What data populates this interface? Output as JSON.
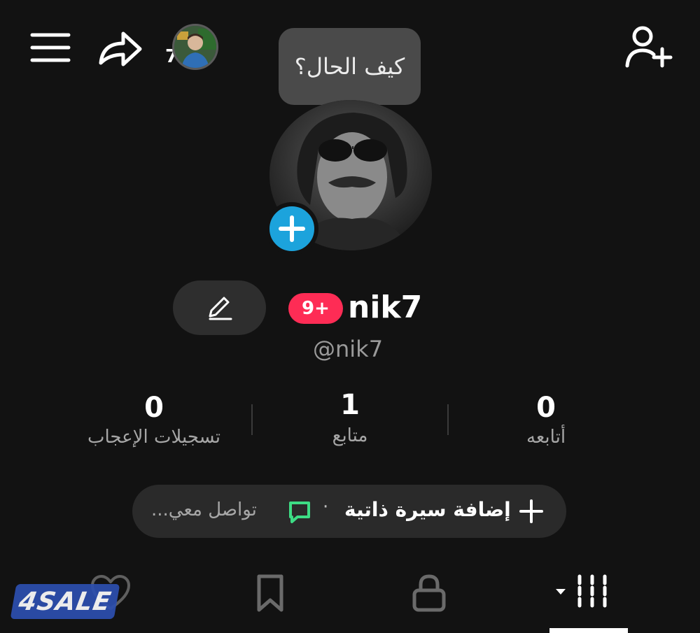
{
  "header": {
    "story_count": "7",
    "note_text": "كيف الحال؟"
  },
  "profile": {
    "display_name": "nik7",
    "badge": "9+",
    "username": "@nik7"
  },
  "stats": [
    {
      "value": "0",
      "label": "تسجيلات الإعجاب"
    },
    {
      "value": "1",
      "label": "متابع"
    },
    {
      "value": "0",
      "label": "أتابعه"
    }
  ],
  "bio": {
    "add_label": "إضافة سيرة ذاتية",
    "separator": "·",
    "contact_label": "تواصل معي..."
  },
  "tabs": [
    {
      "icon": "heart-icon"
    },
    {
      "icon": "bookmark-icon"
    },
    {
      "icon": "lock-icon"
    },
    {
      "icon": "grid-icon",
      "active": true
    }
  ],
  "watermark": "4SALE",
  "colors": {
    "background": "#121212",
    "badge": "#fe2c55",
    "avatar_add": "#1ca3dc",
    "chat_icon": "#3ddc84"
  }
}
